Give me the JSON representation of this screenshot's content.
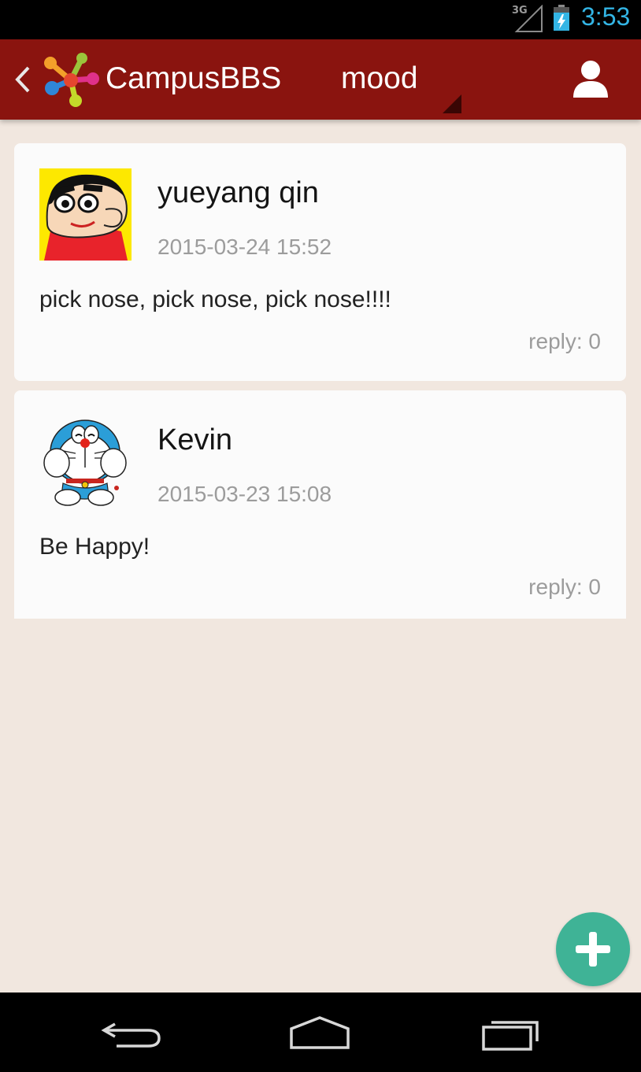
{
  "status_bar": {
    "network": "3G",
    "time": "3:53"
  },
  "header": {
    "app_title": "CampusBBS",
    "section": "mood"
  },
  "posts": [
    {
      "author": "yueyang qin",
      "timestamp": "2015-03-24 15:52",
      "content": "pick nose, pick nose, pick nose!!!!",
      "reply": "reply: 0",
      "avatar": "shin-chan-avatar"
    },
    {
      "author": "Kevin",
      "timestamp": "2015-03-23 15:08",
      "content": "Be Happy!",
      "reply": "reply: 0",
      "avatar": "doraemon-avatar"
    }
  ],
  "colors": {
    "action_bar": "#8a140f",
    "background": "#f1e7df",
    "fab": "#3fb396",
    "clock": "#33b5e5"
  },
  "icons": {
    "back": "chevron-left-icon",
    "logo": "campusbbs-logo-icon",
    "user": "user-profile-icon",
    "fab": "plus-icon",
    "nav": [
      "back-arrow-icon",
      "home-icon",
      "recent-apps-icon"
    ]
  }
}
